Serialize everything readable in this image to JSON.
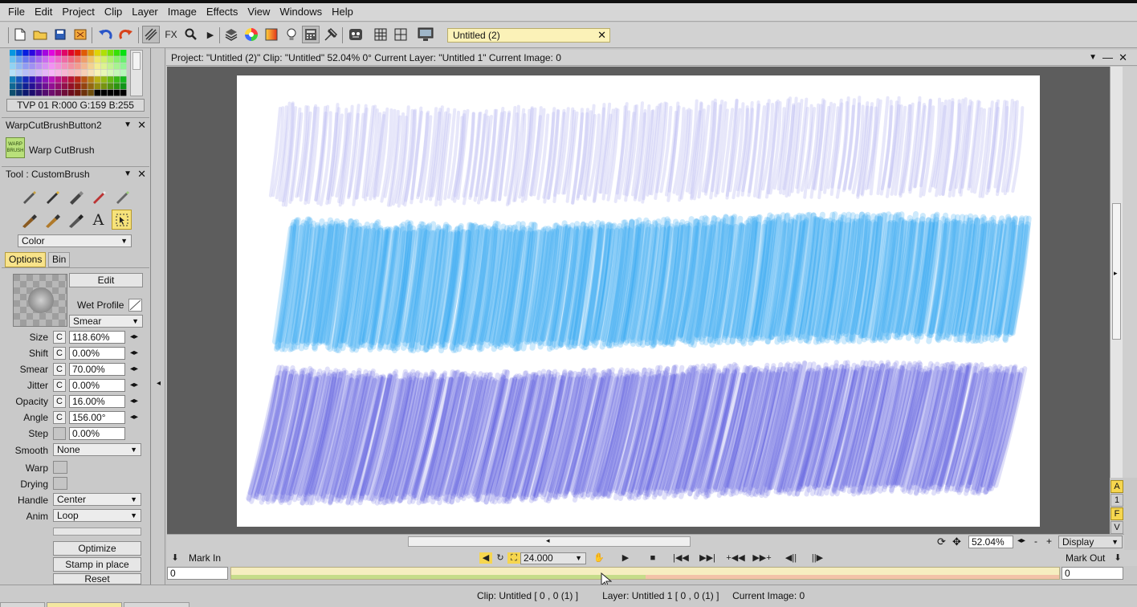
{
  "menu": [
    "File",
    "Edit",
    "Project",
    "Clip",
    "Layer",
    "Image",
    "Effects",
    "View",
    "Windows",
    "Help"
  ],
  "toolbar": {
    "icons": [
      "new-file-icon",
      "open-folder-icon",
      "save-icon",
      "export-icon",
      "undo-icon",
      "redo-icon",
      "brush-lines-icon",
      "fx-icon",
      "magnifier-icon",
      "play-triangle-icon",
      "layers-icon",
      "color-wheel-icon",
      "gradient-icon",
      "lightbulb-icon",
      "calculator-icon",
      "pin-icon",
      "mask-face-icon",
      "grid-icon",
      "split-view-icon",
      "monitor-icon"
    ],
    "fx_label": "FX",
    "document_tab": "Untitled (2)"
  },
  "left": {
    "color_readout": "TVP 01 R:000 G:159 B:255",
    "warp_panel_title": "WarpCutBrushButton2",
    "warp_icon_text": "WARP BRUSH",
    "warp_label": "Warp CutBrush",
    "tool_panel_title": "Tool : CustomBrush",
    "color_mode": "Color",
    "tab_options": "Options",
    "tab_bin": "Bin",
    "edit_button": "Edit",
    "wet_profile_label": "Wet Profile",
    "mode_select": "Smear",
    "params": [
      {
        "label": "Size",
        "c": "C",
        "value": "118.60%"
      },
      {
        "label": "Shift",
        "c": "C",
        "value": "0.00%"
      },
      {
        "label": "Smear",
        "c": "C",
        "value": "70.00%"
      },
      {
        "label": "Jitter",
        "c": "C",
        "value": "0.00%"
      },
      {
        "label": "Opacity",
        "c": "C",
        "value": "16.00%"
      },
      {
        "label": "Angle",
        "c": "C",
        "value": "156.00°"
      },
      {
        "label": "Step",
        "c": "",
        "value": "0.00%"
      }
    ],
    "smooth_label": "Smooth",
    "smooth_value": "None",
    "warp_label2": "Warp",
    "drying_label": "Drying",
    "handle_label": "Handle",
    "handle_value": "Center",
    "anim_label": "Anim",
    "anim_value": "Loop",
    "optimize_button": "Optimize",
    "stamp_button": "Stamp in place",
    "reset_button": "Reset"
  },
  "view": {
    "title": "Project:  \"Untitled (2)\"  Clip: \"Untitled\"   52.04%   0°   Current Layer: \"Untitled 1\"  Current Image: 0",
    "side_buttons": [
      "A",
      "1",
      "F",
      "V"
    ],
    "zoom": "52.04%",
    "display": "Display",
    "zoom_minus": "-",
    "zoom_plus": "+"
  },
  "timeline": {
    "mark_in_label": "Mark In",
    "mark_in_value": "0",
    "fps": "24.000",
    "mark_out_label": "Mark Out",
    "mark_out_value": "0",
    "progress_fraction": 0.5
  },
  "status": {
    "clip": "Clip: Untitled [ 0 , 0  (1) ]",
    "layer": "Layer: Untitled 1 [ 0 , 0  (1) ]",
    "image": "Current Image: 0"
  },
  "colors": {
    "stroke_top": "#b9b9f0",
    "stroke_mid": "#1e9ef0",
    "stroke_bottom": "#3c3cdc",
    "accent_yellow": "#f6e27a"
  }
}
